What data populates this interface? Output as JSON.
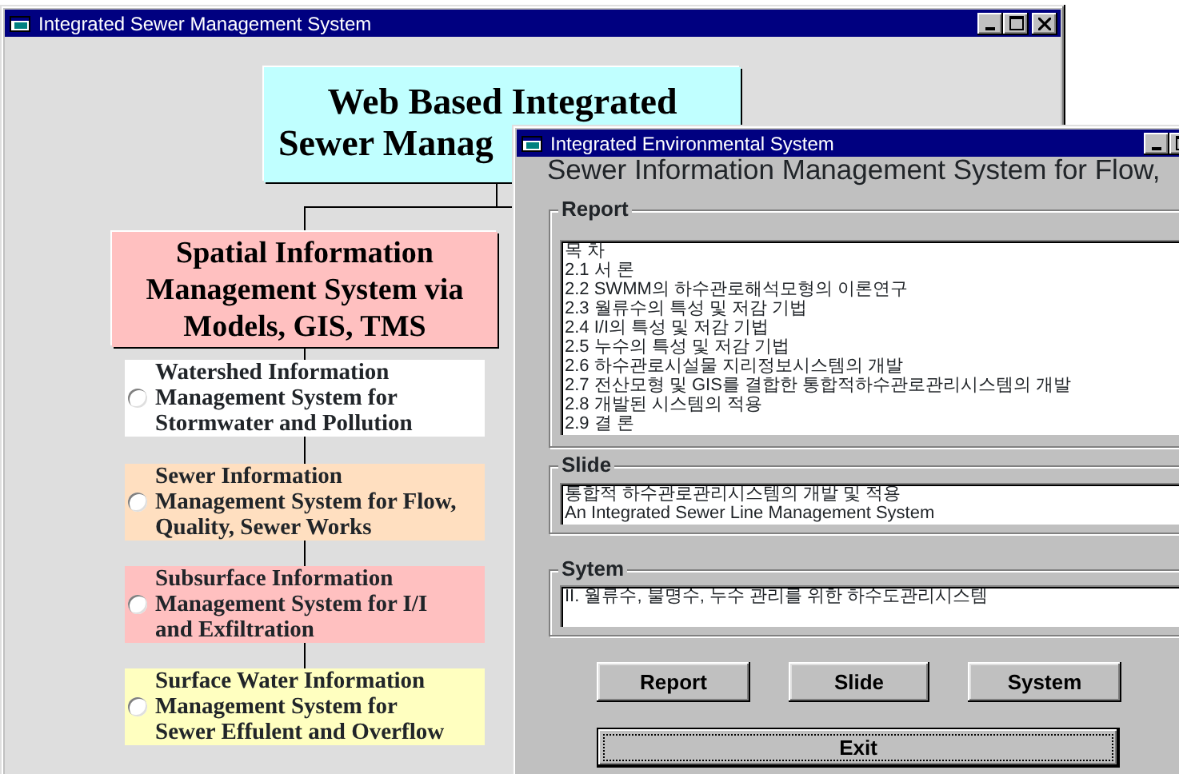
{
  "main_window": {
    "title": "Integrated Sewer Management System",
    "title_box": {
      "lines": [
        "Web Based Integrated",
        "Sewer Manag"
      ]
    },
    "subtitle_box": {
      "lines": [
        "Spatial Information",
        "Management System via",
        "Models, GIS, TMS"
      ]
    },
    "options": [
      {
        "lines": [
          "Watershed Information",
          "Management System for",
          "Stormwater and Pollution"
        ],
        "color": "#ffffff",
        "selected": false
      },
      {
        "lines": [
          "Sewer Information",
          "Management System for Flow,",
          "Quality, Sewer Works"
        ],
        "color": "#ffdfc0",
        "selected": false
      },
      {
        "lines": [
          "Subsurface Information",
          "Management System for I/I",
          "and Exfiltration"
        ],
        "color": "#ffc0c0",
        "selected": false
      },
      {
        "lines": [
          "Surface Water Information",
          "Management System for",
          "Sewer Effulent and Overflow"
        ],
        "color": "#ffffc0",
        "selected": false
      }
    ]
  },
  "dialog": {
    "title": "Integrated Environmental System",
    "heading": [
      "Sewer Information Management System for Flow,"
    ],
    "groups": [
      {
        "label": "Report",
        "lines": [
          "목 차",
          "2.1 서 론",
          "2.2 SWMM의 하수관로해석모형의 이론연구",
          "2.3 월류수의 특성 및 저감 기법",
          "2.4 I/I의 특성 및 저감 기법",
          "2.5 누수의 특성 및 저감 기법",
          "2.6 하수관로시설물 지리정보시스템의 개발",
          "2.7 전산모형 및 GIS를 결합한 통합적하수관로관리시스템의 개발",
          "2.8 개발된 시스템의 적용",
          "2.9 결 론"
        ]
      },
      {
        "label": "Slide",
        "lines": [
          "통합적 하수관로관리시스템의 개발 및 적용",
          "An Integrated Sewer Line Management System"
        ]
      },
      {
        "label": "Sytem",
        "lines": [
          "II. 월류수, 불명수, 누수 관리를 위한 하수도관리시스템"
        ]
      }
    ],
    "buttons": [
      "Report",
      "Slide",
      "System"
    ],
    "exit_button": "Exit"
  }
}
